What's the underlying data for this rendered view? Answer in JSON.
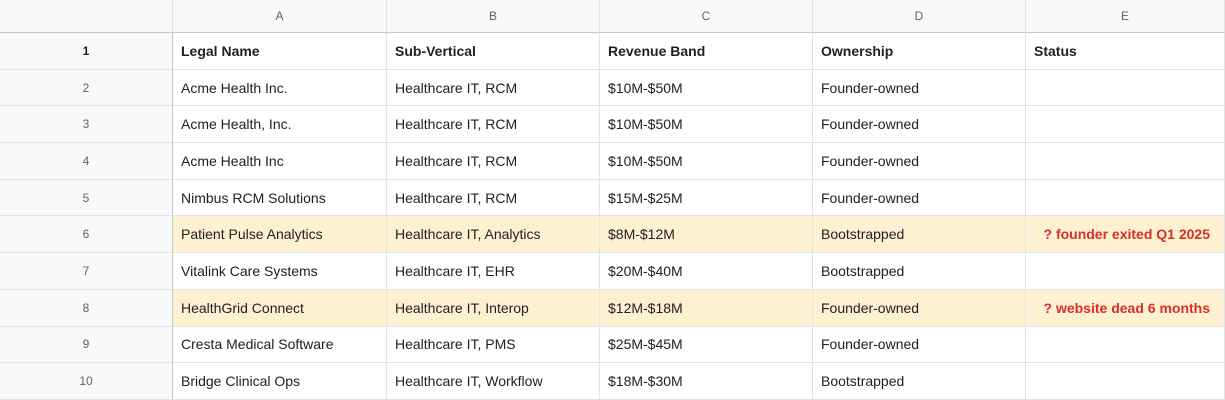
{
  "columns": [
    "A",
    "B",
    "C",
    "D",
    "E"
  ],
  "row_numbers": [
    "1",
    "2",
    "3",
    "4",
    "5",
    "6",
    "7",
    "8",
    "9",
    "10"
  ],
  "header_row": [
    "Legal Name",
    "Sub-Vertical",
    "Revenue Band",
    "Ownership",
    "Status"
  ],
  "rows": [
    [
      "Acme Health Inc.",
      "Healthcare IT, RCM",
      "$10M-$50M",
      "Founder-owned",
      ""
    ],
    [
      "Acme Health, Inc.",
      "Healthcare IT, RCM",
      "$10M-$50M",
      "Founder-owned",
      ""
    ],
    [
      "Acme Health Inc",
      "Healthcare IT, RCM",
      "$10M-$50M",
      "Founder-owned",
      ""
    ],
    [
      "Nimbus RCM Solutions",
      "Healthcare IT, RCM",
      "$15M-$25M",
      "Founder-owned",
      ""
    ],
    [
      "Patient Pulse Analytics",
      "Healthcare IT, Analytics",
      "$8M-$12M",
      "Bootstrapped",
      "? founder exited Q1 2025"
    ],
    [
      "Vitalink Care Systems",
      "Healthcare IT, EHR",
      "$20M-$40M",
      "Bootstrapped",
      ""
    ],
    [
      "HealthGrid Connect",
      "Healthcare IT, Interop",
      "$12M-$18M",
      "Founder-owned",
      "? website dead 6 months"
    ],
    [
      "Cresta Medical Software",
      "Healthcare IT, PMS",
      "$25M-$45M",
      "Founder-owned",
      ""
    ],
    [
      "Bridge Clinical Ops",
      "Healthcare IT, Workflow",
      "$18M-$30M",
      "Bootstrapped",
      ""
    ]
  ],
  "highlighted_rows": [
    "6",
    "8"
  ],
  "colors": {
    "highlight_fill": "#fdf1d1",
    "flag_text": "#d93025",
    "header_fill": "#f8f9fa"
  }
}
